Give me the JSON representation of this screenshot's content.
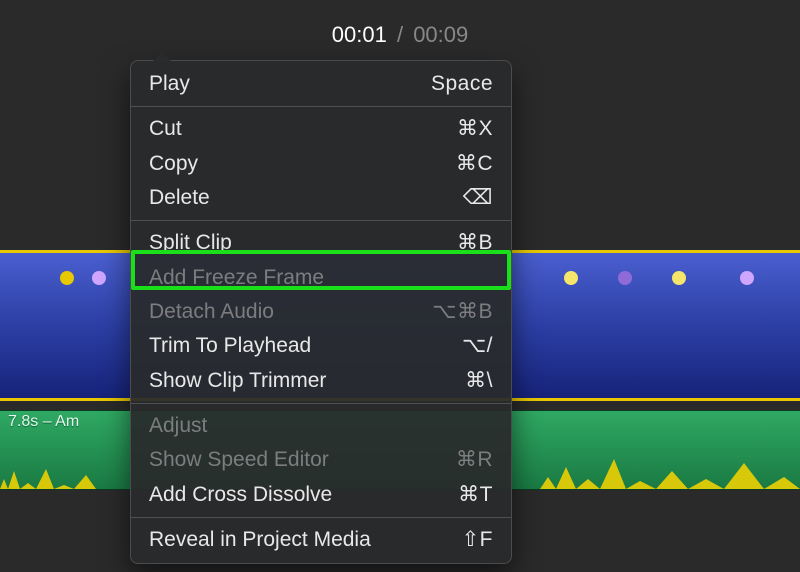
{
  "timecode": {
    "current": "00:01",
    "duration": "00:09",
    "sep": "/"
  },
  "audio_track": {
    "label": "7.8s – Am"
  },
  "menu": {
    "items": [
      {
        "id": "play",
        "label": "Play",
        "shortcut": "Space",
        "enabled": true
      },
      {
        "sep": true
      },
      {
        "id": "cut",
        "label": "Cut",
        "shortcut": "⌘X",
        "enabled": true
      },
      {
        "id": "copy",
        "label": "Copy",
        "shortcut": "⌘C",
        "enabled": true
      },
      {
        "id": "delete",
        "label": "Delete",
        "shortcut_icon": "delete",
        "enabled": true
      },
      {
        "sep": true
      },
      {
        "id": "split",
        "label": "Split Clip",
        "shortcut": "⌘B",
        "enabled": true,
        "highlighted": true
      },
      {
        "id": "freeze",
        "label": "Add Freeze Frame",
        "shortcut": "",
        "enabled": false
      },
      {
        "id": "detach",
        "label": "Detach Audio",
        "shortcut": "⌥⌘B",
        "enabled": false
      },
      {
        "id": "trim",
        "label": "Trim To Playhead",
        "shortcut": "⌥/",
        "enabled": true
      },
      {
        "id": "trimmer",
        "label": "Show Clip Trimmer",
        "shortcut": "⌘\\",
        "enabled": true
      },
      {
        "sep": true
      },
      {
        "id": "adjust",
        "label": "Adjust",
        "shortcut": "",
        "enabled": false
      },
      {
        "id": "speed",
        "label": "Show Speed Editor",
        "shortcut": "⌘R",
        "enabled": false
      },
      {
        "id": "dissolve",
        "label": "Add Cross Dissolve",
        "shortcut": "⌘T",
        "enabled": true
      },
      {
        "sep": true
      },
      {
        "id": "reveal",
        "label": "Reveal in Project Media",
        "shortcut": "⇧F",
        "enabled": true
      }
    ]
  }
}
